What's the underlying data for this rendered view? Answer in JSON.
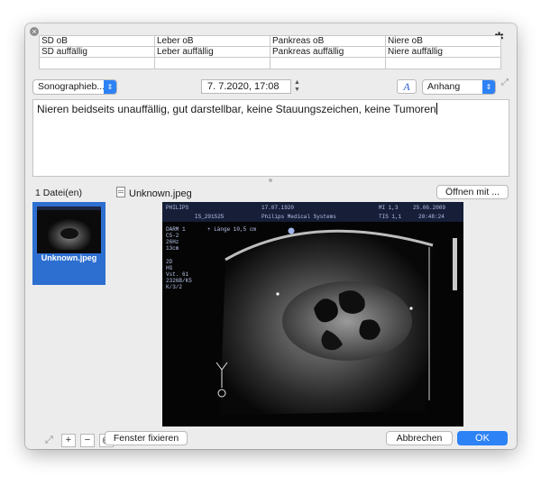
{
  "conditions": {
    "row1": [
      "SD oB",
      "Leber oB",
      "Pankreas oB",
      "Niere oB"
    ],
    "row2": [
      "SD auffällig",
      "Leber auffällig",
      "Pankreas auffällig",
      "Niere auffällig"
    ]
  },
  "toolbar": {
    "category_select": "Sonographieb...",
    "datetime": "7.  7.2020, 17:08",
    "font_button": "A",
    "attachment_select": "Anhang"
  },
  "note_text": "Nieren beidseits unauffällig, gut darstellbar, keine Stauungszeichen, keine Tumoren",
  "files": {
    "count_label": "1 Datei(en)",
    "selected_name": "Unknown.jpeg",
    "open_with_label": "Öffnen mit ...",
    "thumbnail_label": "Unknown.jpeg"
  },
  "ultrasound": {
    "brand": "PHILIPS",
    "date": "17.07.1920",
    "mi": "MI 1,3",
    "date2": "25.06.2009",
    "patient_id": "IS_291525",
    "company": "Philips Medical Systems",
    "tis": "TIS 1,1",
    "time": "20:48:24",
    "probe": [
      "DARM 1",
      "C5-2",
      "26Hz",
      "13cm"
    ],
    "measure": "+ Länge  10,5 cm",
    "mode": [
      "2D",
      "HG",
      "Vst. 61",
      "2326B/K5",
      "K/3/2"
    ]
  },
  "footer": {
    "fix_window_label": "Fenster fixieren",
    "cancel_label": "Abbrechen",
    "ok_label": "OK"
  }
}
